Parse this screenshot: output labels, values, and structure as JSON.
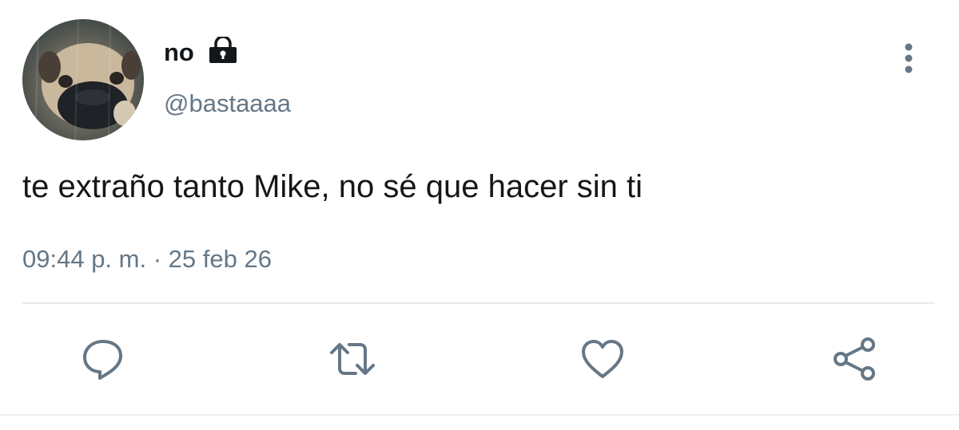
{
  "tweet": {
    "display_name": "no",
    "handle": "@bastaaaa",
    "text": "te extraño tanto Mike, no sé que hacer sin ti",
    "time": "09:44 p. m.",
    "separator": "·",
    "date": "25 feb 26"
  },
  "icons": {
    "lock": "lock-icon",
    "more": "more-vertical-icon",
    "reply": "reply-icon",
    "retweet": "retweet-icon",
    "like": "heart-icon",
    "share": "share-icon"
  },
  "colors": {
    "primary_text": "#14171a",
    "secondary_text": "#657786",
    "icon": "#657786",
    "divider": "#e6ecf0",
    "background": "#ffffff"
  }
}
